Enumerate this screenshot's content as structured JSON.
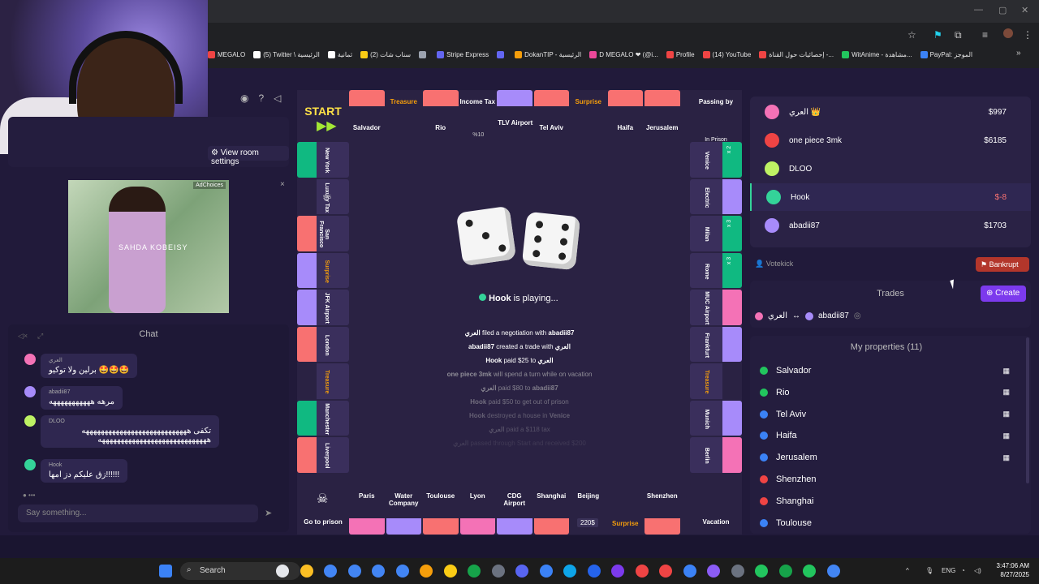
{
  "bookmarks": [
    {
      "label": "MEGALO",
      "color": "#ef4444"
    },
    {
      "label": "(5) Twitter \\ الرئيسية",
      "color": "#ffffff"
    },
    {
      "label": "ثمانية",
      "color": "#ffffff"
    },
    {
      "label": "(2) سناب شات",
      "color": "#facc15"
    },
    {
      "label": "",
      "color": "#9ca3af"
    },
    {
      "label": "Stripe Express",
      "color": "#6366f1"
    },
    {
      "label": "",
      "color": "#6366f1"
    },
    {
      "label": "DokanTIP - الرئيسية",
      "color": "#f59e0b"
    },
    {
      "label": "D MEGALO ❤ (@i...",
      "color": "#ec4899"
    },
    {
      "label": "Profile",
      "color": "#ef4444"
    },
    {
      "label": "(14) YouTube",
      "color": "#ef4444"
    },
    {
      "label": "إحصائيات حول القناة -...",
      "color": "#ef4444"
    },
    {
      "label": "WitAnime - مشاهدة...",
      "color": "#22c55e"
    },
    {
      "label": "PayPal: الموجز",
      "color": "#3b82f6"
    }
  ],
  "room": {
    "settings_label": "View room settings"
  },
  "ad": {
    "label": "AdChoices",
    "brand": "SAHDA KOBEISY",
    "close": "×"
  },
  "chat": {
    "title": "Chat",
    "placeholder": "Say something...",
    "messages": [
      {
        "name": "العري",
        "text": "برلين ولا توكيو 🤩🤩🤩",
        "color": "#f472b6"
      },
      {
        "name": "abadii87",
        "text": "مرهه هههههههههههه",
        "color": "#a78bfa"
      },
      {
        "name": "DLOO",
        "text": "تكفى ههههههههههههههههههههههههههههه هههههههههههههههههههههههههههههه",
        "color": "#bef264"
      },
      {
        "name": "Hook",
        "text": "زق عليكم دز امها!!!!!!",
        "color": "#34d399"
      }
    ]
  },
  "board": {
    "top": [
      "START",
      "Salvador",
      "Treasure",
      "Rio",
      "Income Tax",
      "",
      "Tel Aviv",
      "Surprise",
      "Haifa",
      "Jerusalem",
      "Passing by"
    ],
    "top_extra": {
      "income_tax_sub": "%10",
      "tlv": "TLV Airport",
      "prison": "In Prison"
    },
    "left": [
      "New York",
      "Luxury Tax",
      "San Francisco",
      "Surprise",
      "JFK Airport",
      "London",
      "Treasure",
      "Manchester",
      "Liverpool"
    ],
    "left_extra": {
      "luxury_sub": "$75"
    },
    "right": [
      "Venice",
      "Electric",
      "Milan",
      "Rome",
      "MUC Airport",
      "Frankfurt",
      "Treasure",
      "Munich",
      "Berlin"
    ],
    "right_multipliers": [
      "x 2",
      "x 3",
      "x 3"
    ],
    "bottom": [
      "Go to prison",
      "Paris",
      "Water Company",
      "Toulouse",
      "Lyon",
      "CDG Airport",
      "Shanghai",
      "Beijing",
      "Surprise",
      "Shenzhen",
      "Vacation"
    ],
    "bottom_extra": {
      "beijing_price": "220$"
    },
    "status": {
      "player": "Hook",
      "text": "is playing..."
    },
    "log": [
      {
        "a": "العري",
        "act": "filed a negotiation with",
        "b": "abadii87",
        "op": 1
      },
      {
        "a": "abadii87",
        "act": "created a trade with",
        "b": "العري",
        "op": 1
      },
      {
        "a": "Hook",
        "act": "paid $25 to",
        "b": "العري",
        "op": 1
      },
      {
        "a": "one piece 3mk",
        "act": "will spend a turn while on vacation",
        "b": "",
        "op": 0.7
      },
      {
        "a": "العري",
        "act": "paid $80 to",
        "b": "abadii87",
        "op": 0.6
      },
      {
        "a": "Hook",
        "act": "paid $50 to get out of prison",
        "b": "",
        "op": 0.5
      },
      {
        "a": "Hook",
        "act": "destroyed a house in",
        "b": "Venice",
        "op": 0.4
      },
      {
        "a": "العري",
        "act": "paid a $118 tax",
        "b": "",
        "op": 0.3
      },
      {
        "a": "العري",
        "act": "passed through Start and received $200",
        "b": "",
        "op": 0.15
      }
    ]
  },
  "players": [
    {
      "name": "العري 👑",
      "money": "$997",
      "color": "#f472b6",
      "money_color": "#ffffff"
    },
    {
      "name": "one piece 3mk",
      "money": "$6185",
      "color": "#ef4444",
      "money_color": "#ffffff"
    },
    {
      "name": "DLOO",
      "money": "",
      "color": "#bef264",
      "money_color": "#ffffff"
    },
    {
      "name": "Hook",
      "money": "$-8",
      "color": "#34d399",
      "money_color": "#f87171"
    },
    {
      "name": "abadii87",
      "money": "$1703",
      "color": "#a78bfa",
      "money_color": "#ffffff"
    }
  ],
  "actions": {
    "votekick": "Votekick",
    "bankrupt": "Bankrupt",
    "trades_title": "Trades",
    "create": "Create"
  },
  "trade": {
    "from": "العري",
    "to": "abadii87",
    "arrow": "↔"
  },
  "properties": {
    "title": "My properties (11)",
    "items": [
      {
        "name": "Salvador",
        "flag": "#22c55e",
        "house": true
      },
      {
        "name": "Rio",
        "flag": "#22c55e",
        "house": true
      },
      {
        "name": "Tel Aviv",
        "flag": "#3b82f6",
        "house": true
      },
      {
        "name": "Haifa",
        "flag": "#3b82f6",
        "house": true
      },
      {
        "name": "Jerusalem",
        "flag": "#3b82f6",
        "house": true
      },
      {
        "name": "Shenzhen",
        "flag": "#ef4444",
        "house": false
      },
      {
        "name": "Shanghai",
        "flag": "#ef4444",
        "house": false
      },
      {
        "name": "Toulouse",
        "flag": "#3b82f6",
        "house": false
      }
    ]
  },
  "taskbar": {
    "search": "Search",
    "time": "3:47:06 AM",
    "date": "8/27/2025",
    "lang": "ENG"
  }
}
